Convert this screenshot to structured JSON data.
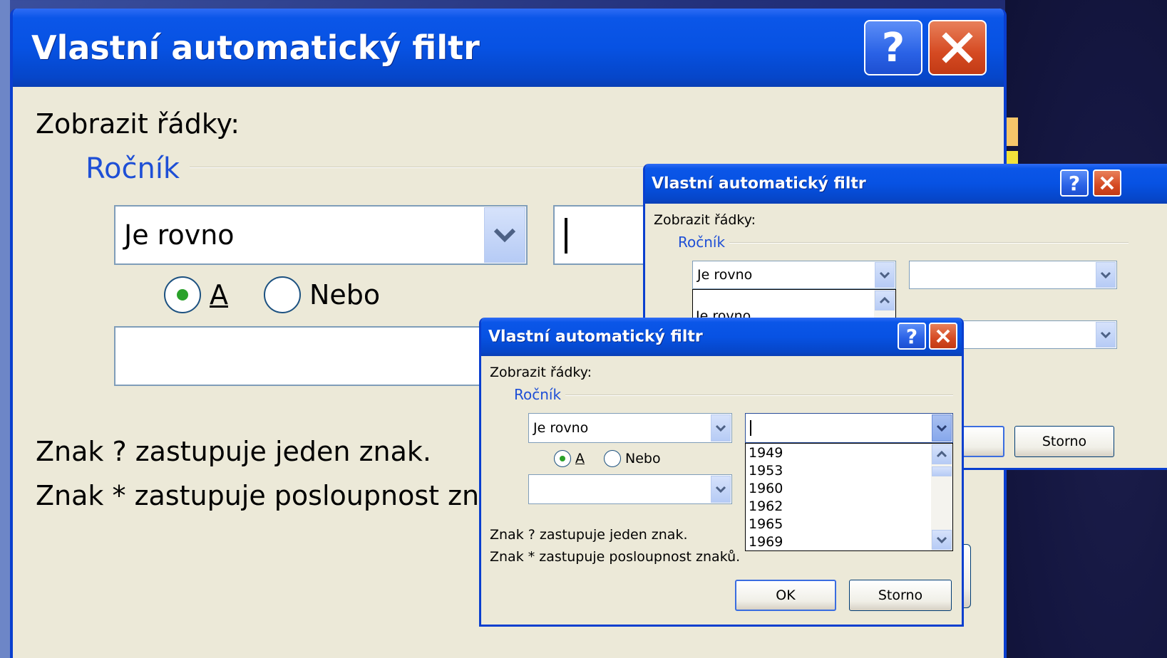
{
  "dialog": {
    "title": "Vlastní automatický filtr",
    "help_label": "?",
    "show_rows_label": "Zobrazit řádky:",
    "field_group": "Ročník",
    "operator1": "Je rovno",
    "and_label": "A",
    "or_label": "Nebo",
    "hint1": "Znak ? zastupuje jeden znak.",
    "hint2": "Znak * zastupuje posloupnost znaků.",
    "ok_label": "OK",
    "cancel_label": "Storno"
  },
  "big_dialog": {
    "hint2_visible": "Znak * zastupuje posloupnost zna"
  },
  "mid_dialog": {
    "dropdown_partial": "Je rovno"
  },
  "front_dialog": {
    "value_list": [
      "1949",
      "1953",
      "1960",
      "1962",
      "1965",
      "1969"
    ]
  },
  "colors": {
    "title_blue": "#0752e3",
    "close_red": "#d54a22",
    "group_blue": "#1e4fd6",
    "dialog_bg": "#ece9d8"
  }
}
